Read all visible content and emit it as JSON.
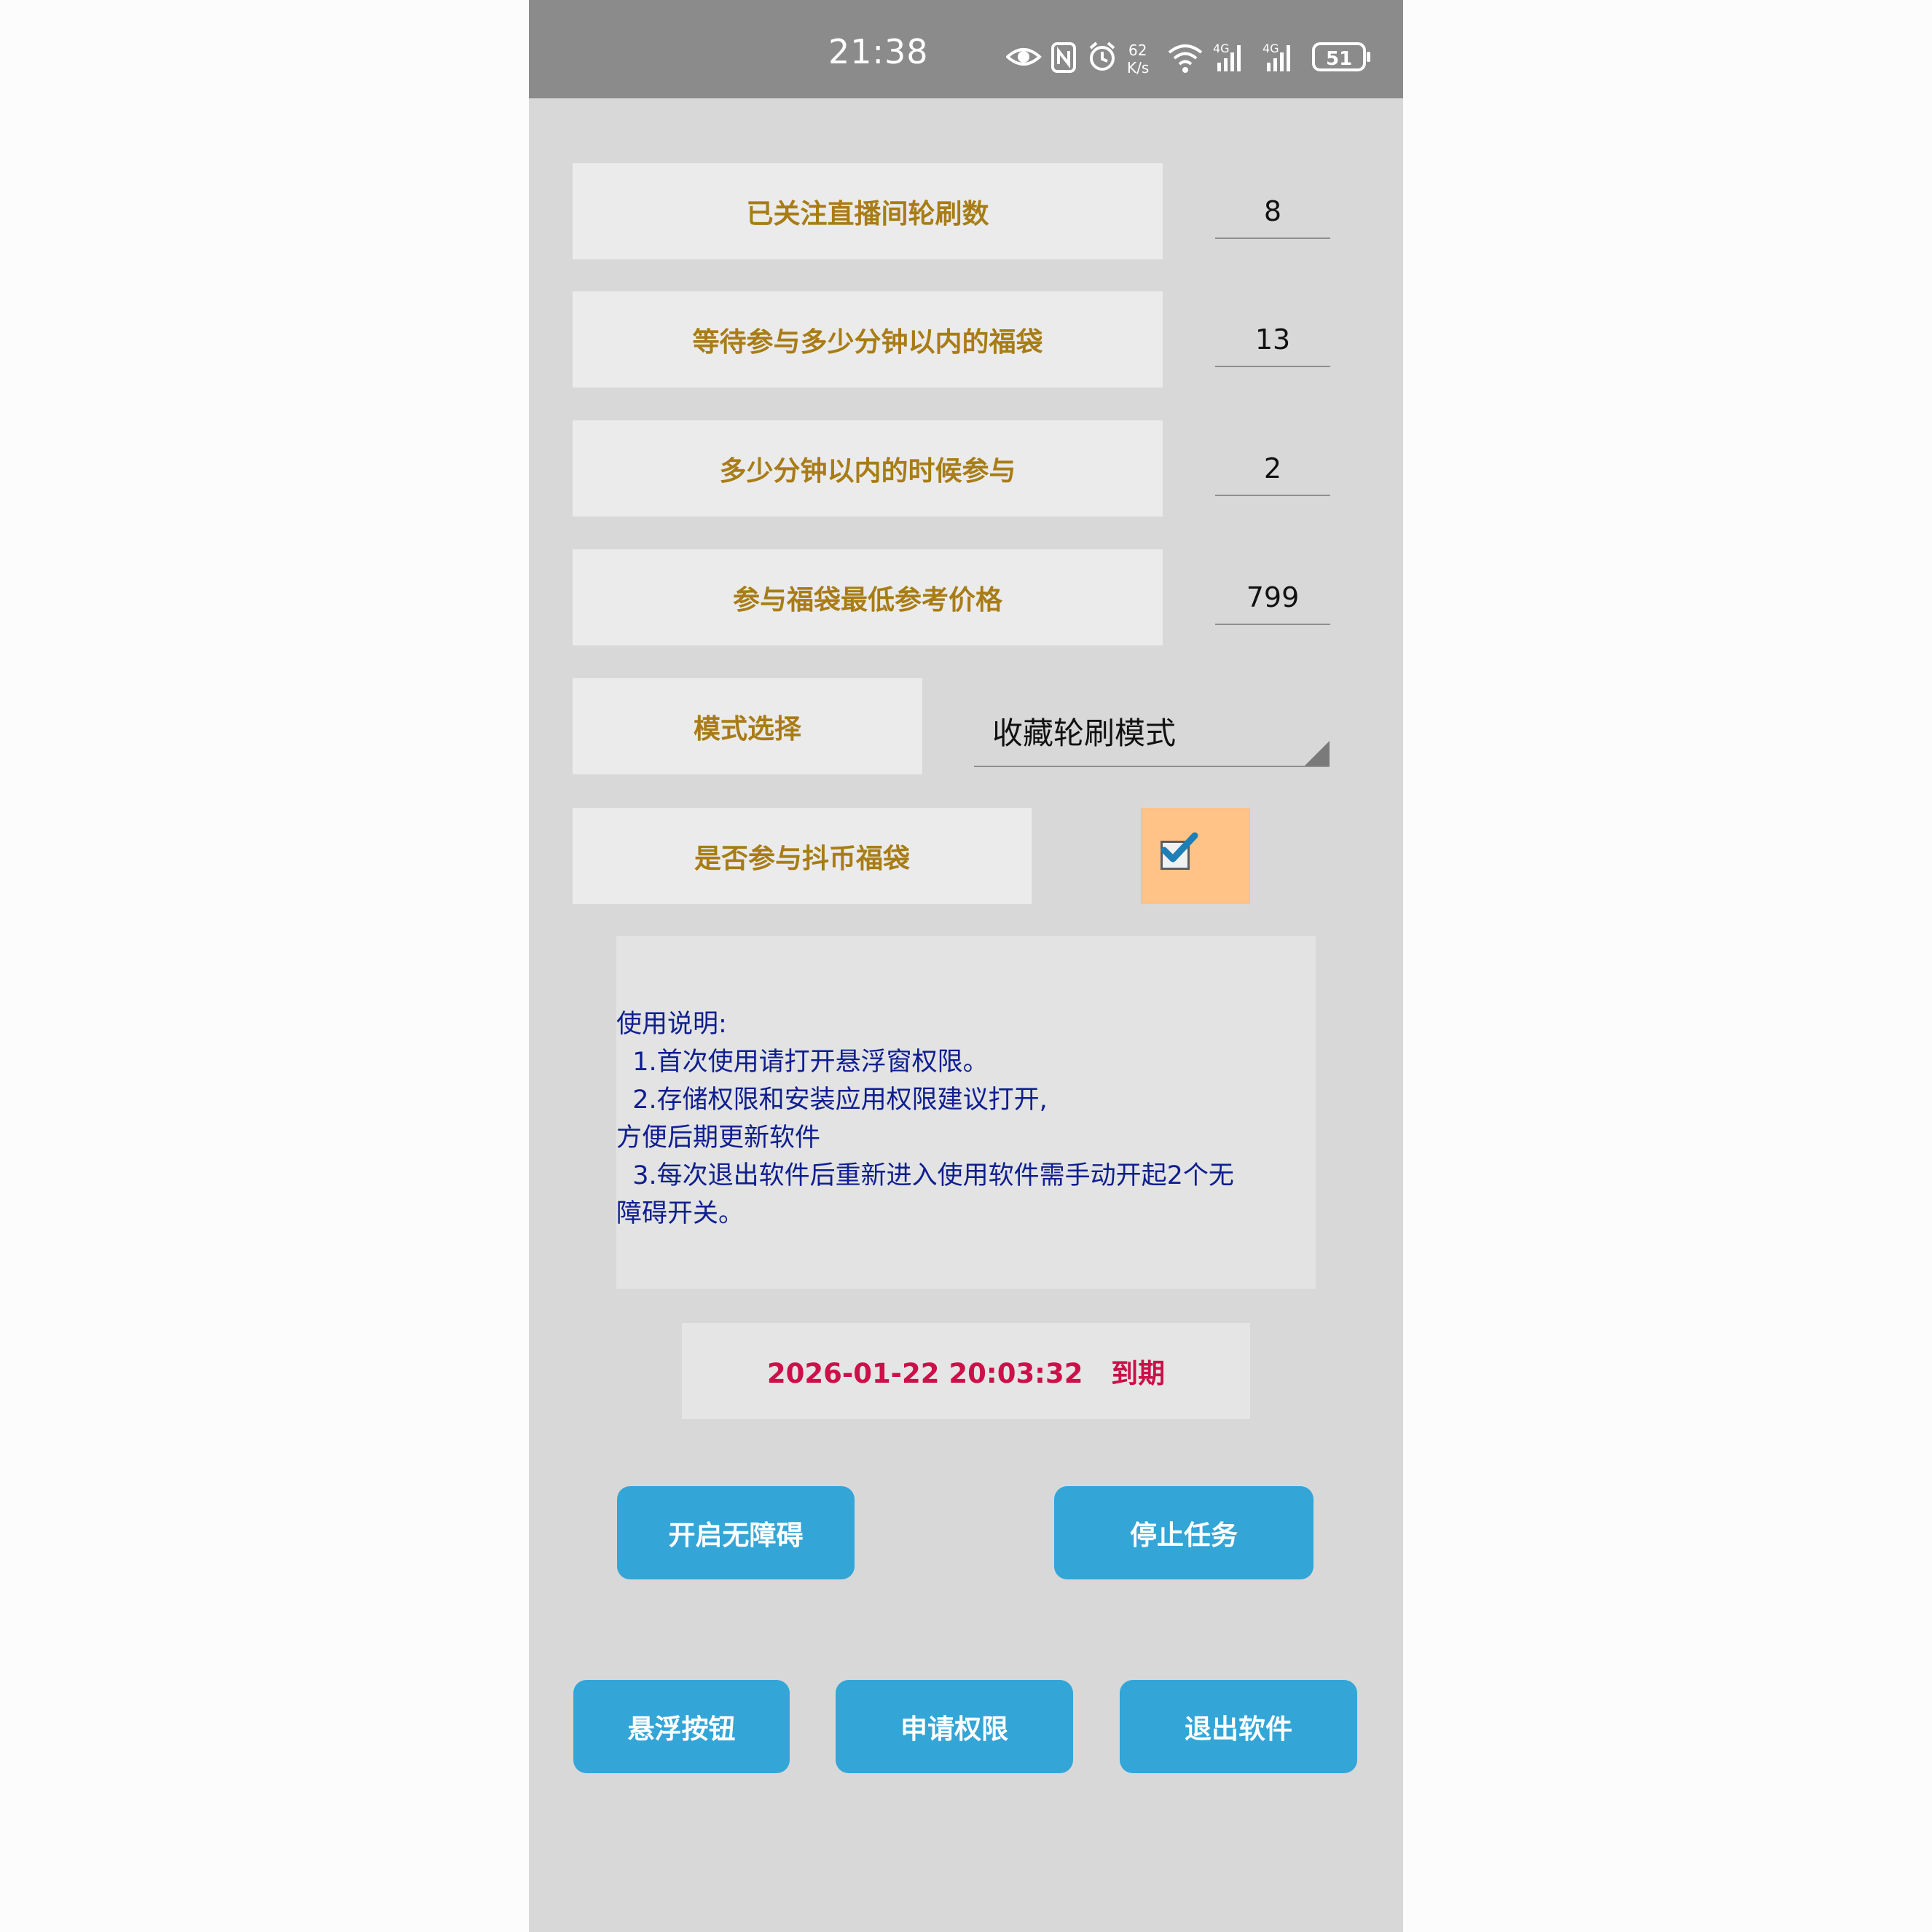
{
  "status_bar": {
    "time": "21:38",
    "net_speed_value": "62",
    "net_speed_unit": "K/s",
    "sim1": "4G",
    "sim2": "4G",
    "battery": "51",
    "icons": [
      "eye-icon",
      "nfc-icon",
      "alarm-icon",
      "wifi-icon",
      "signal-icon",
      "signal-icon",
      "battery-icon"
    ]
  },
  "settings": {
    "follow_rounds": {
      "label": "已关注直播间轮刷数",
      "value": "8"
    },
    "wait_minutes": {
      "label": "等待参与多少分钟以内的福袋",
      "value": "13"
    },
    "join_minutes": {
      "label": "多少分钟以内的时候参与",
      "value": "2"
    },
    "min_price": {
      "label": "参与福袋最低参考价格",
      "value": "799"
    },
    "mode": {
      "label": "模式选择",
      "selected": "收藏轮刷模式"
    },
    "coin_bag": {
      "label": "是否参与抖币福袋",
      "checked": true
    }
  },
  "instructions": {
    "title": "使用说明:",
    "lines": [
      "  1.首次使用请打开悬浮窗权限。",
      "  2.存储权限和安装应用权限建议打开,",
      "方便后期更新软件",
      "  3.每次退出软件后重新进入使用软件需手动开起2个无",
      "障碍开关。"
    ]
  },
  "expiry": {
    "text": "2026-01-22 20:03:32   到期"
  },
  "buttons": {
    "enable_accessibility": "开启无障碍",
    "stop_task": "停止任务",
    "float_button": "悬浮按钮",
    "request_permission": "申请权限",
    "exit_app": "退出软件"
  },
  "colors": {
    "status_bar": "#8b8b8b",
    "background": "#d8d8d8",
    "label_text": "#a87c16",
    "instruction_text": "#0f1f8f",
    "expiry_text": "#cc1049",
    "button": "#33a5d7",
    "checkbox_bg": "#ffc287"
  }
}
